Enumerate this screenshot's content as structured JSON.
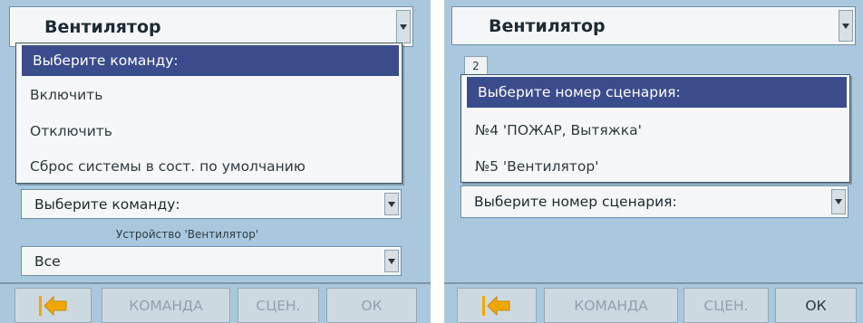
{
  "left": {
    "title": "Вентилятор",
    "dropdown_items": [
      "Выберите команду:",
      "Включить",
      "Отключить",
      "Сброс системы в сост. по умолчанию"
    ],
    "command_select": "Выберите команду:",
    "device_label": "Устройство 'Вентилятор'",
    "device_select": "Все",
    "buttons": {
      "command": "КОМАНДА",
      "scenario": "СЦЕН.",
      "ok": "ОК"
    }
  },
  "right": {
    "title": "Вентилятор",
    "tab_label": "2",
    "dropdown_items": [
      "Выберите номер сценария:",
      "№4  'ПОЖАР, Вытяжка'",
      "№5  'Вентилятор'"
    ],
    "scenario_select": "Выберите номер сценария:",
    "buttons": {
      "command": "КОМАНДА",
      "scenario": "СЦЕН.",
      "ok": "ОК"
    }
  },
  "colors": {
    "panel_bg": "#a9c8dd",
    "selection": "#3b4c8c",
    "back_icon": "#f0a800"
  },
  "icons": {
    "back": "back-arrow-icon",
    "dropdown": "chevron-down-icon"
  }
}
